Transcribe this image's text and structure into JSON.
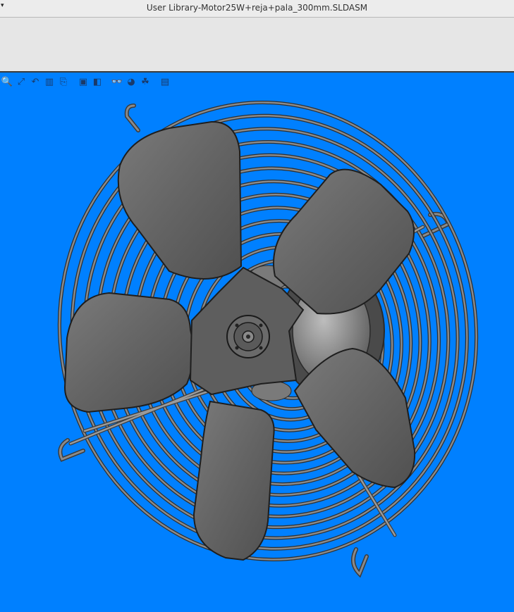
{
  "window": {
    "title": "User Library-Motor25W+reja+pala_300mm.SLDASM",
    "menu_caret": "▾"
  },
  "viewport": {
    "background": "#0080ff"
  },
  "heads_up_toolbar": {
    "icons": [
      "zoom-to-fit-icon",
      "zoom-to-area-icon",
      "previous-view-icon",
      "section-view-icon",
      "dynamic-annotation-views-icon",
      "view-orientation-icon",
      "display-style-icon",
      "hide-show-items-icon",
      "edit-appearance-icon",
      "apply-scene-icon",
      "view-settings-icon"
    ]
  },
  "model": {
    "name": "Motor25W+reja+pala_300mm",
    "components": [
      "guard-grille",
      "motor",
      "fan-blades"
    ],
    "blade_count": 5,
    "grille_color": "#8a8a8a",
    "blade_color": "#626262"
  }
}
